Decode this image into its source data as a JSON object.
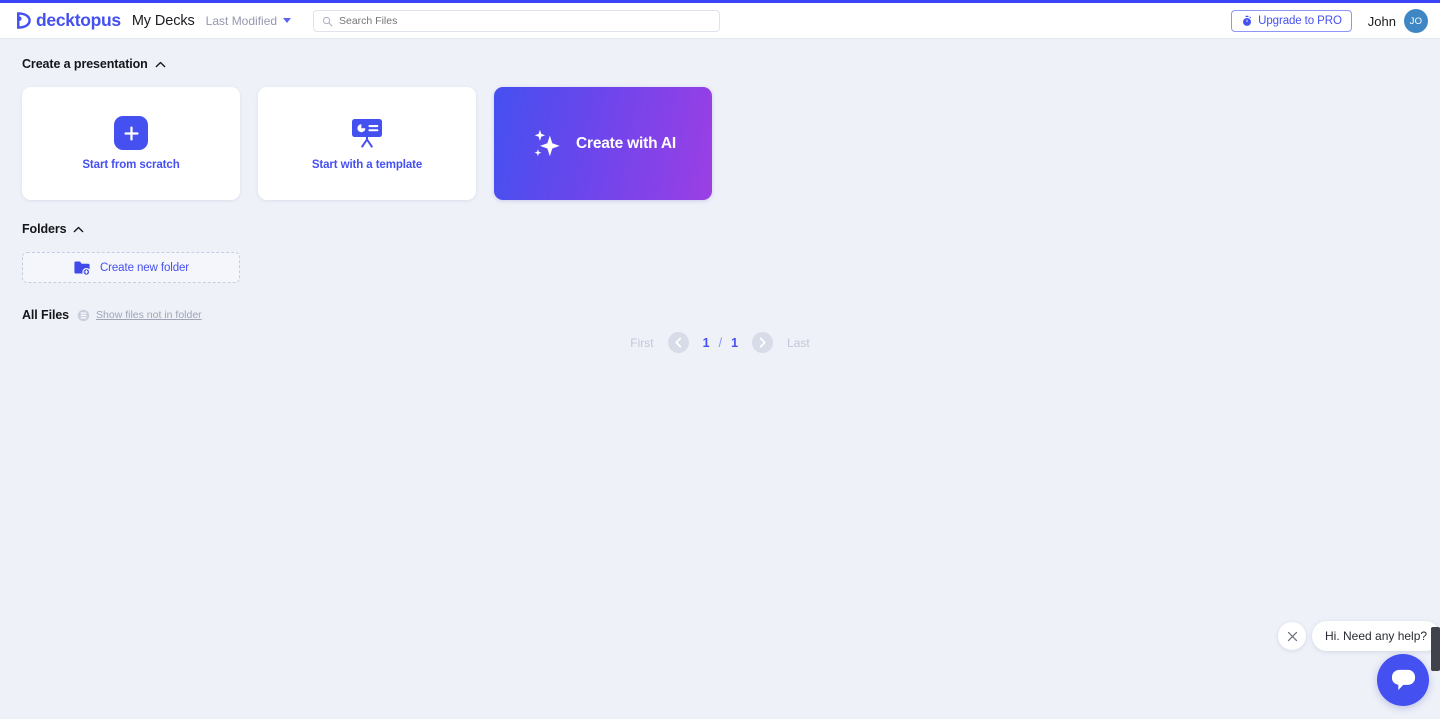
{
  "brand": {
    "name": "decktopus",
    "logo_icon": "decktopus-logo-icon",
    "accent_color": "#4550f0"
  },
  "header": {
    "workspace_title": "My Decks",
    "sort": {
      "label": "Last Modified",
      "caret_icon": "chevron-down-icon"
    },
    "search": {
      "placeholder": "Search Files",
      "value": "",
      "icon": "search-icon"
    },
    "upgrade": {
      "label": "Upgrade to PRO",
      "icon": "stopwatch-icon",
      "border_color": "#8f95f5"
    },
    "user": {
      "name": "John",
      "avatar_initials": "JO",
      "avatar_color": "#3f87c4"
    }
  },
  "create_section": {
    "title": "Create a presentation",
    "collapse_icon": "chevron-up-icon",
    "cards": [
      {
        "label": "Start from scratch",
        "icon": "plus-icon"
      },
      {
        "label": "Start with a template",
        "icon": "presentation-board-icon"
      }
    ],
    "ai_card": {
      "label": "Create with AI",
      "icon": "sparkles-icon",
      "gradient_from": "#4550f0",
      "gradient_to": "#9b3fe4"
    }
  },
  "folders_section": {
    "title": "Folders",
    "collapse_icon": "chevron-up-icon",
    "create_folder": {
      "label": "Create new folder",
      "icon": "folder-plus-icon"
    }
  },
  "all_files_section": {
    "title": "All Files",
    "filter_icon": "list-circle-icon",
    "show_not_in_folder_link": "Show files not in folder"
  },
  "pagination": {
    "first_label": "First",
    "last_label": "Last",
    "prev_icon": "chevron-left-icon",
    "next_icon": "chevron-right-icon",
    "current_page": "1",
    "separator": "/",
    "total_pages": "1"
  },
  "chat_widget": {
    "message": "Hi. Need any help?",
    "close_icon": "close-icon",
    "launcher_icon": "chat-bubble-icon",
    "launcher_color": "#4550f0"
  }
}
